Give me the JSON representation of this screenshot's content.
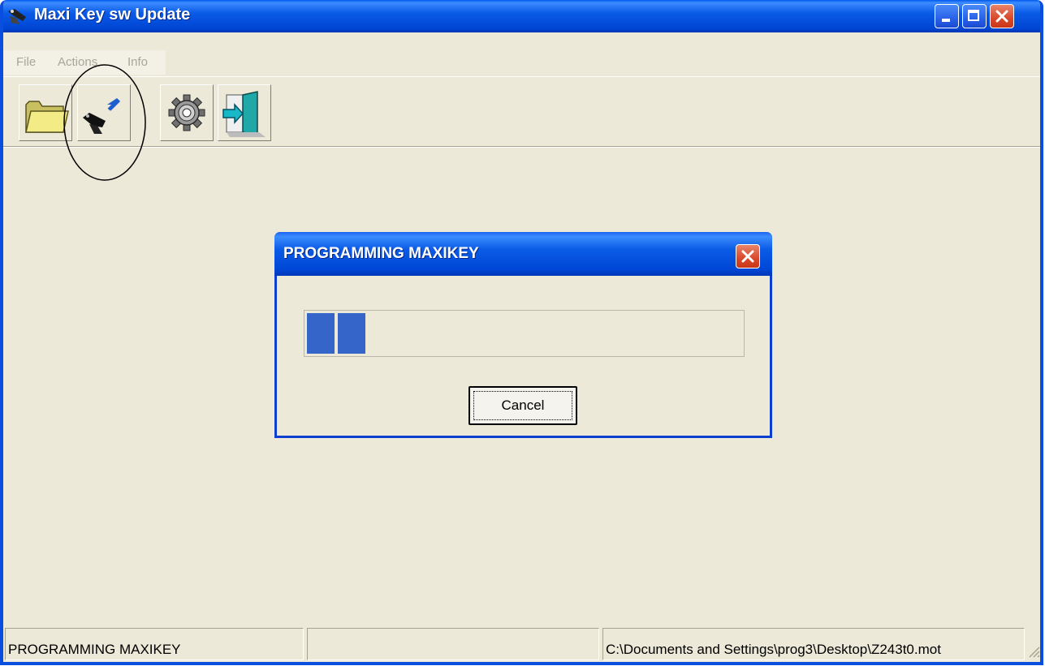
{
  "window": {
    "title": "Maxi Key sw Update",
    "menu": [
      "File",
      "Actions",
      "Info"
    ],
    "toolbar_icons": [
      "open-folder-icon",
      "program-key-icon",
      "settings-gear-icon",
      "exit-door-icon"
    ]
  },
  "dialog": {
    "title": "PROGRAMMING MAXIKEY",
    "cancel_label": "Cancel",
    "progress_blocks": 2
  },
  "statusbar": {
    "panel1": "PROGRAMMING MAXIKEY",
    "panel2": "",
    "panel3": "C:\\Documents and Settings\\prog3\\Desktop\\Z243t0.mot"
  },
  "colors": {
    "titlebar": "#0a5be6",
    "window_bg": "#ece9d8",
    "progress": "#3565c8",
    "close_button": "#d9482a"
  }
}
